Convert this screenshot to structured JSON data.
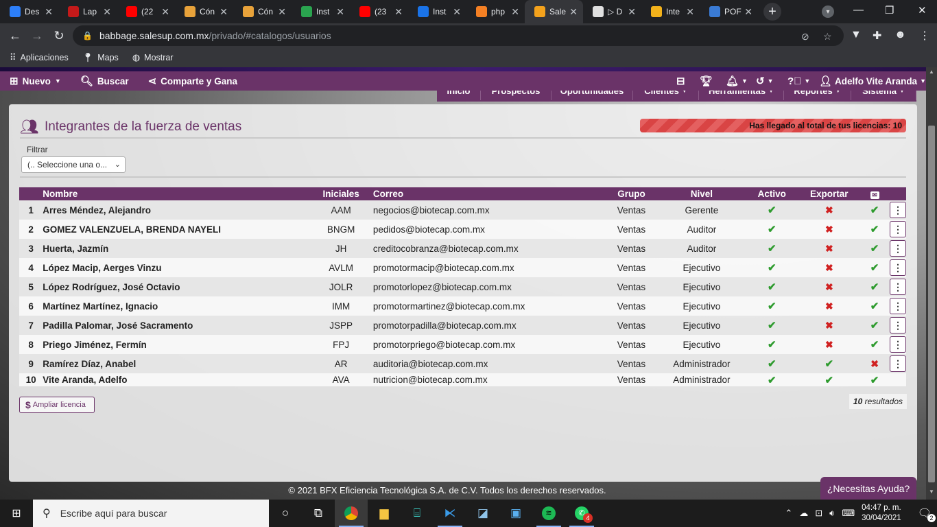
{
  "browser": {
    "tabs": [
      {
        "title": "Des",
        "color": "#2d7ff9",
        "icon": "grid-icon"
      },
      {
        "title": "Lap",
        "color": "#c41a1a",
        "icon": "store-icon"
      },
      {
        "title": "(22",
        "color": "#ff0000",
        "icon": "youtube-icon"
      },
      {
        "title": "Cón",
        "color": "#e8a23a",
        "icon": "doc-icon"
      },
      {
        "title": "Cón",
        "color": "#e8a23a",
        "icon": "doc-icon"
      },
      {
        "title": "Inst",
        "color": "#2aa44f",
        "icon": "chrome-icon"
      },
      {
        "title": "(23",
        "color": "#ff0000",
        "icon": "youtube-icon"
      },
      {
        "title": "Inst",
        "color": "#1a73e8",
        "icon": "app-icon"
      },
      {
        "title": "php",
        "color": "#f48024",
        "icon": "stack-icon"
      },
      {
        "title": "Sale",
        "color": "#f4a21c",
        "icon": "salesup-icon"
      },
      {
        "title": "▷ D",
        "color": "#e0e0e0",
        "icon": "globe-icon"
      },
      {
        "title": "Inte",
        "color": "#f3b21b",
        "icon": "b-icon"
      },
      {
        "title": "POF",
        "color": "#3a7bd5",
        "icon": "infinity-icon"
      }
    ],
    "active_tab": 9,
    "url_host": "babbage.salesup.com.mx",
    "url_path": "/privado/#catalogos/usuarios",
    "bookmarks": [
      {
        "label": "Aplicaciones",
        "icon": "apps-icon"
      },
      {
        "label": "Maps",
        "icon": "maps-pin-icon"
      },
      {
        "label": "Mostrar",
        "icon": "globe-icon"
      }
    ]
  },
  "appnav": {
    "nuevo": "Nuevo",
    "buscar": "Buscar",
    "comparte": "Comparte y Gana",
    "user": "Adelfo Vite Aranda"
  },
  "submenu": [
    {
      "label": "Inicio",
      "caret": false,
      "w": 64
    },
    {
      "label": "Prospectos",
      "caret": false,
      "w": 103
    },
    {
      "label": "Oportunidades",
      "caret": false,
      "w": 119
    },
    {
      "label": "Clientes",
      "caret": true,
      "w": 96
    },
    {
      "label": "Herramientas",
      "caret": true,
      "w": 124
    },
    {
      "label": "Reportes",
      "caret": true,
      "w": 98
    },
    {
      "label": "Sistema",
      "caret": true,
      "w": 95
    }
  ],
  "page": {
    "title": "Integrantes de la fuerza de ventas",
    "license_notice": "Has llegado al total de tus licencias: 10",
    "filter_label": "Filtrar",
    "filter_value": "(.. Seleccione una o...",
    "extend_license": "Ampliar licencia",
    "results_count": "10",
    "results_label": "resultados"
  },
  "table": {
    "headers": [
      "",
      "Nombre",
      "Iniciales",
      "Correo",
      "Grupo",
      "Nivel",
      "Activo",
      "Exportar",
      "",
      ""
    ],
    "rows": [
      {
        "n": "1",
        "name": "Arres Méndez, Alejandro",
        "ini": "AAM",
        "mail": "negocios@biotecap.com.mx",
        "grp": "Ventas",
        "lvl": "Gerente",
        "act": true,
        "exp": false,
        "eml": true,
        "menu": true
      },
      {
        "n": "2",
        "name": "GOMEZ VALENZUELA, BRENDA NAYELI",
        "ini": "BNGM",
        "mail": "pedidos@biotecap.com.mx",
        "grp": "Ventas",
        "lvl": "Auditor",
        "act": true,
        "exp": false,
        "eml": true,
        "menu": true
      },
      {
        "n": "3",
        "name": "Huerta, Jazmín",
        "ini": "JH",
        "mail": "creditocobranza@biotecap.com.mx",
        "grp": "Ventas",
        "lvl": "Auditor",
        "act": true,
        "exp": false,
        "eml": true,
        "menu": true
      },
      {
        "n": "4",
        "name": "López Macip, Aerges Vinzu",
        "ini": "AVLM",
        "mail": "promotormacip@biotecap.com.mx",
        "grp": "Ventas",
        "lvl": "Ejecutivo",
        "act": true,
        "exp": false,
        "eml": true,
        "menu": true
      },
      {
        "n": "5",
        "name": "López Rodríguez, José Octavio",
        "ini": "JOLR",
        "mail": "promotorlopez@biotecap.com.mx",
        "grp": "Ventas",
        "lvl": "Ejecutivo",
        "act": true,
        "exp": false,
        "eml": true,
        "menu": true
      },
      {
        "n": "6",
        "name": "Martínez Martínez, Ignacio",
        "ini": "IMM",
        "mail": "promotormartinez@biotecap.com.mx",
        "grp": "Ventas",
        "lvl": "Ejecutivo",
        "act": true,
        "exp": false,
        "eml": true,
        "menu": true
      },
      {
        "n": "7",
        "name": "Padilla Palomar, José Sacramento",
        "ini": "JSPP",
        "mail": "promotorpadilla@biotecap.com.mx",
        "grp": "Ventas",
        "lvl": "Ejecutivo",
        "act": true,
        "exp": false,
        "eml": true,
        "menu": true
      },
      {
        "n": "8",
        "name": "Priego Jiménez, Fermín",
        "ini": "FPJ",
        "mail": "promotorpriego@biotecap.com.mx",
        "grp": "Ventas",
        "lvl": "Ejecutivo",
        "act": true,
        "exp": false,
        "eml": true,
        "menu": true
      },
      {
        "n": "9",
        "name": "Ramírez Díaz, Anabel",
        "ini": "AR",
        "mail": "auditoria@biotecap.com.mx",
        "grp": "Ventas",
        "lvl": "Administrador",
        "act": true,
        "exp": true,
        "eml": false,
        "menu": true
      },
      {
        "n": "10",
        "name": "Vite Aranda, Adelfo",
        "ini": "AVA",
        "mail": "nutricion@biotecap.com.mx",
        "grp": "Ventas",
        "lvl": "Administrador",
        "act": true,
        "exp": true,
        "eml": true,
        "menu": false
      }
    ]
  },
  "footer": "© 2021 BFX Eficiencia Tecnológica S.A. de C.V. Todos los derechos reservados.",
  "help": "¿Necesitas Ayuda?",
  "taskbar": {
    "search_placeholder": "Escribe aquí para buscar",
    "time": "04:47 p. m.",
    "date": "30/04/2021",
    "whatsapp_badge": "4",
    "notifications": "2"
  },
  "colors": {
    "brand": "#6a3368",
    "ok": "#2e9b2e",
    "no": "#d02020",
    "license_bar": "#e46060"
  }
}
